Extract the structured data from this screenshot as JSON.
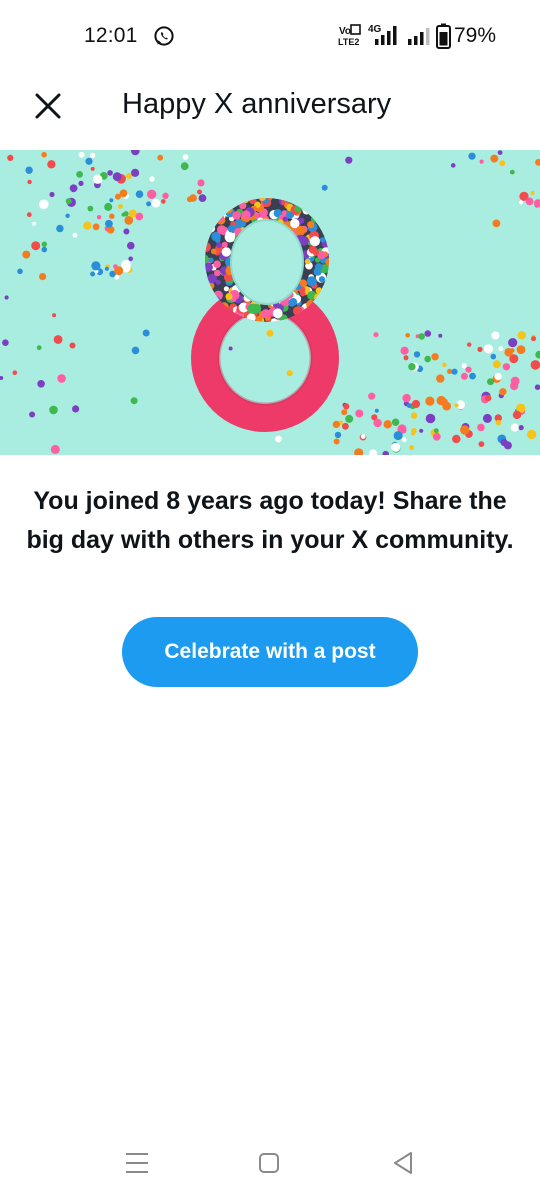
{
  "status_bar": {
    "time": "12:01",
    "battery": "79%",
    "network_labels": {
      "volte_top": "Vo",
      "volte_bottom": "LTE2",
      "data": "4G"
    },
    "icons": [
      "whatsapp-icon",
      "volte-icon",
      "signal-icon",
      "battery-icon"
    ]
  },
  "header": {
    "title": "Happy X anniversary",
    "close_icon": "close-icon"
  },
  "hero": {
    "number_shown": "8",
    "colors": {
      "background": "#a9ece0",
      "paper": "#ee3a69",
      "confetti": [
        "#f24b4b",
        "#2a8ed8",
        "#f7c318",
        "#3fb84d",
        "#7d3fc2",
        "#f47c20",
        "#ff5fa2",
        "#ffffff"
      ]
    }
  },
  "main": {
    "message": "You joined 8 years ago today! Share the big day with others in your X community.",
    "celebrate_label": "Celebrate with a post"
  },
  "colors": {
    "accent": "#1d9bf0",
    "text": "#0f1419"
  },
  "nav_bar": {
    "icons": [
      "recents-icon",
      "home-icon",
      "back-icon"
    ]
  }
}
